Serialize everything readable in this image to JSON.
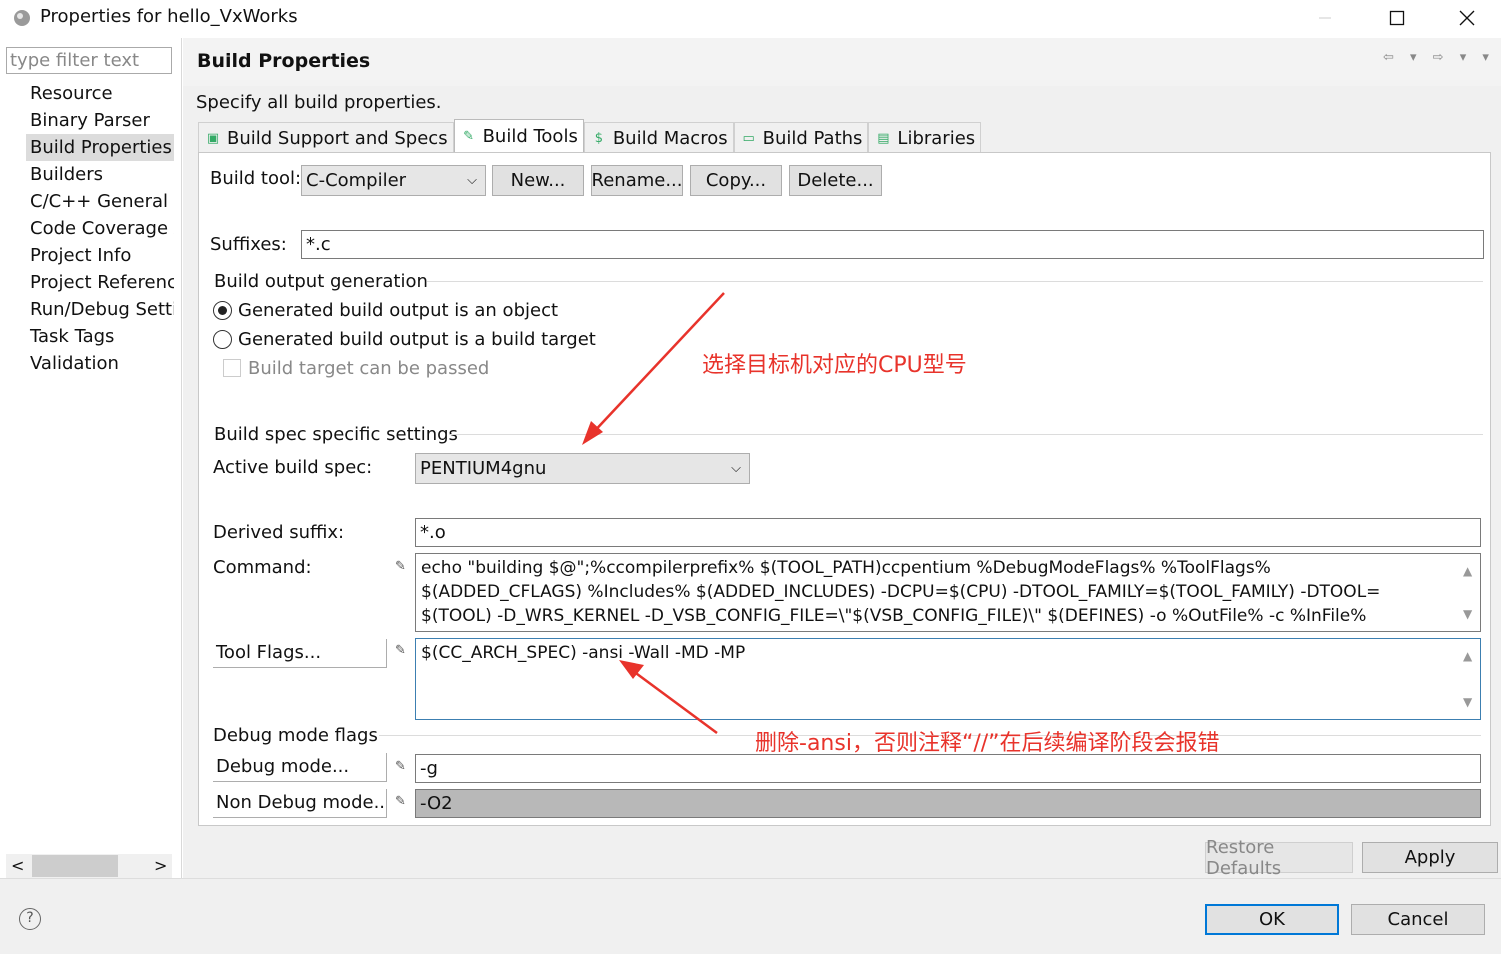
{
  "window": {
    "title": "Properties for hello_VxWorks",
    "minimize_icon": "minimize-icon",
    "maximize_icon": "maximize-icon",
    "close_icon": "close-icon"
  },
  "sidebar": {
    "filter_placeholder": "type filter text",
    "items": [
      {
        "label": "Resource"
      },
      {
        "label": "Binary Parser"
      },
      {
        "label": "Build Properties",
        "selected": true
      },
      {
        "label": "Builders"
      },
      {
        "label": "C/C++ General"
      },
      {
        "label": "Code Coverage A"
      },
      {
        "label": "Project Info"
      },
      {
        "label": "Project Reference"
      },
      {
        "label": "Run/Debug Setti"
      },
      {
        "label": "Task Tags"
      },
      {
        "label": "Validation"
      }
    ],
    "scroll_left": "<",
    "scroll_right": ">"
  },
  "header": {
    "title": "Build Properties",
    "nav_arrows": "⇦ ▾ ⇨ ▾ ▾"
  },
  "main": {
    "subtitle": "Specify all build properties.",
    "tabs": [
      {
        "label": "Build Support and Specs",
        "icon": "build-support-icon",
        "glyph": "▣"
      },
      {
        "label": "Build Tools",
        "icon": "build-tools-icon",
        "glyph": "✎",
        "active": true
      },
      {
        "label": "Build Macros",
        "icon": "build-macros-icon",
        "glyph": "$"
      },
      {
        "label": "Build Paths",
        "icon": "build-paths-icon",
        "glyph": "▭"
      },
      {
        "label": "Libraries",
        "icon": "libraries-icon",
        "glyph": "▤"
      }
    ],
    "build_tool": {
      "label": "Build tool:",
      "value": "C-Compiler",
      "new_label": "New...",
      "rename_label": "Rename...",
      "copy_label": "Copy...",
      "delete_label": "Delete..."
    },
    "suffixes": {
      "label": "Suffixes:",
      "value": "*.c"
    },
    "output_group": {
      "title": "Build output generation",
      "radio_object": "Generated build output is an object",
      "radio_target": "Generated build output is a build target",
      "checkbox_pass": "Build target can be passed"
    },
    "spec_group": {
      "title": "Build spec specific settings",
      "active_label": "Active build spec:",
      "active_value": "PENTIUM4gnu",
      "derived_label": "Derived suffix:",
      "derived_value": "*.o",
      "command_label": "Command:",
      "command_lines": [
        "echo \"building $@\";%ccompilerprefix% $(TOOL_PATH)ccpentium %DebugModeFlags% %ToolFlags%",
        "$(ADDED_CFLAGS) %Includes% $(ADDED_INCLUDES) -DCPU=$(CPU) -DTOOL_FAMILY=$(TOOL_FAMILY) -DTOOL=",
        "$(TOOL) -D_WRS_KERNEL  -D_VSB_CONFIG_FILE=\\\"$(VSB_CONFIG_FILE)\\\"   $(DEFINES) -o %OutFile% -c %InFile%"
      ],
      "tool_flags_label": "Tool Flags...",
      "tool_flags_value": "$(CC_ARCH_SPEC)  -ansi  -Wall   -MD -MP"
    },
    "debug_group": {
      "title": "Debug mode flags",
      "debug_label": "Debug mode...",
      "debug_value": "-g",
      "nondebug_label": "Non Debug mode...",
      "nondebug_value": "-O2"
    },
    "annotations": {
      "cpu_note": "选择目标机对应的CPU型号",
      "ansi_note": "删除-ansi，否则注释“//”在后续编译阶段会报错"
    },
    "restore_defaults_label": "Restore Defaults",
    "apply_label": "Apply"
  },
  "footer": {
    "help_icon": "help-icon",
    "ok_label": "OK",
    "cancel_label": "Cancel"
  },
  "colors": {
    "annotation": "#e8332b",
    "panel_bg": "#f0f0f0",
    "ok_border": "#0078d7"
  }
}
